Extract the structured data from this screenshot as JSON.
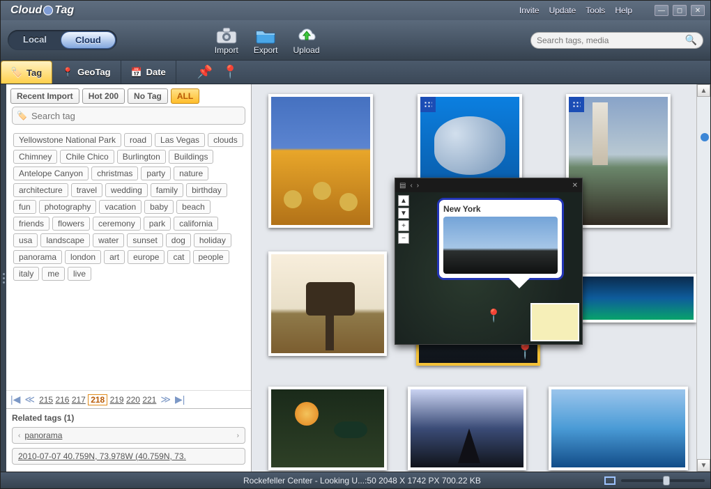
{
  "title": "CloudTag",
  "menu": {
    "invite": "Invite",
    "update": "Update",
    "tools": "Tools",
    "help": "Help"
  },
  "pills": {
    "local": "Local",
    "cloud": "Cloud"
  },
  "toolbar": {
    "import": "Import",
    "export": "Export",
    "upload": "Upload"
  },
  "search": {
    "placeholder": "Search tags, media"
  },
  "tabs": {
    "tag": "Tag",
    "geotag": "GeoTag",
    "date": "Date"
  },
  "filters": {
    "recent": "Recent Import",
    "hot": "Hot 200",
    "notag": "No Tag",
    "all": "ALL"
  },
  "tagsearch": {
    "placeholder": "Search tag"
  },
  "tags": [
    "Yellowstone National Park",
    "road",
    "Las Vegas",
    "clouds",
    "Chimney",
    "Chile Chico",
    "Burlington",
    "Buildings",
    "Antelope Canyon",
    "christmas",
    "party",
    "nature",
    "architecture",
    "travel",
    "wedding",
    "family",
    "birthday",
    "fun",
    "photography",
    "vacation",
    "baby",
    "beach",
    "friends",
    "flowers",
    "ceremony",
    "park",
    "california",
    "usa",
    "landscape",
    "water",
    "sunset",
    "dog",
    "holiday",
    "panorama",
    "london",
    "art",
    "europe",
    "cat",
    "people",
    "italy",
    "me",
    "live"
  ],
  "pager": {
    "pages": [
      "215",
      "216",
      "217",
      "218",
      "219",
      "220",
      "221"
    ],
    "current": "218"
  },
  "related": {
    "heading": "Related tags (1)",
    "tag": "panorama",
    "info": "2010-07-07 40.759N, 73.978W (40.759N, 73."
  },
  "map": {
    "title": "New York"
  },
  "status": {
    "text": "Rockefeller Center - Looking U...:50 2048 X 1742 PX 700.22 KB"
  }
}
